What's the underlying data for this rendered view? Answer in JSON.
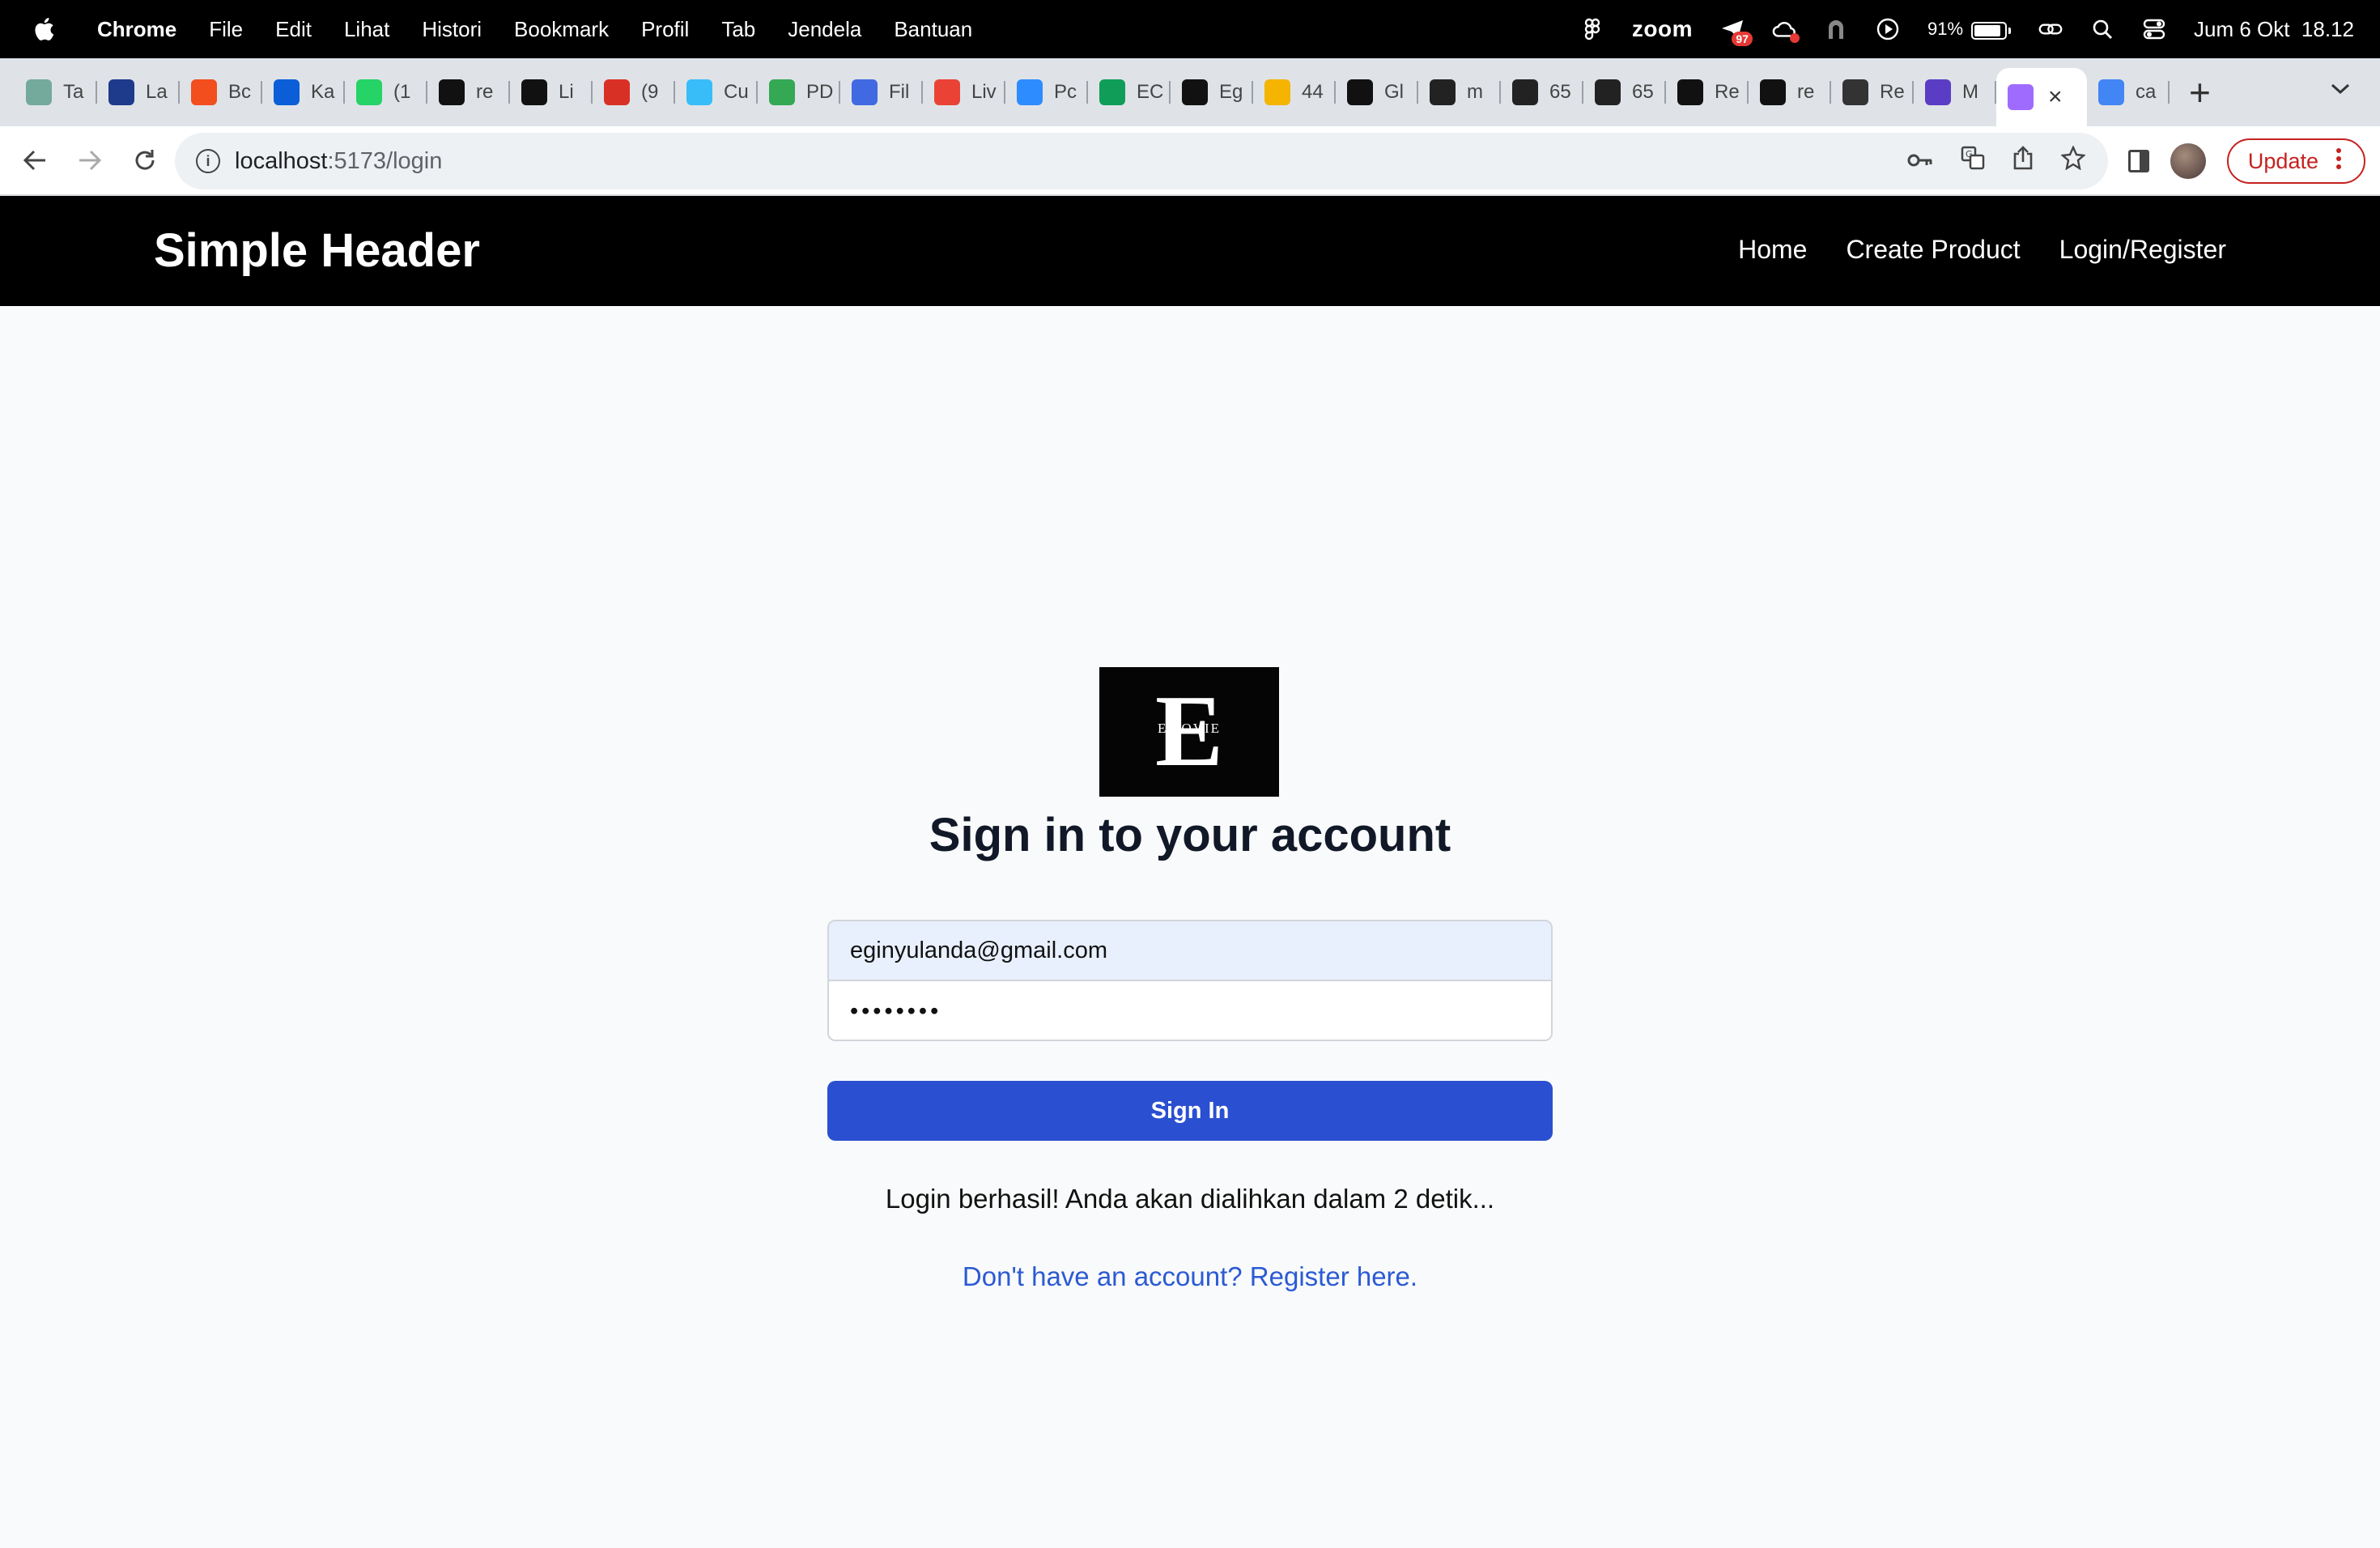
{
  "menubar": {
    "app": "Chrome",
    "items": [
      "File",
      "Edit",
      "Lihat",
      "Histori",
      "Bookmark",
      "Profil",
      "Tab",
      "Jendela",
      "Bantuan"
    ],
    "zoom_label": "zoom",
    "notification_count": "97",
    "battery_percent": "91%",
    "battery_level": 0.91,
    "datetime": "Jum 6 Okt  18.12"
  },
  "tabs": [
    {
      "title": "Ta",
      "icon": "chatgpt-icon",
      "color": "#74aa9c"
    },
    {
      "title": "La",
      "icon": "one-icon",
      "color": "#1e3a8a"
    },
    {
      "title": "Bc",
      "icon": "figma-icon",
      "color": "#f24e1e"
    },
    {
      "title": "Ka",
      "icon": "bank-icon",
      "color": "#0b5ed7"
    },
    {
      "title": "(1",
      "icon": "whatsapp-icon",
      "color": "#25d366"
    },
    {
      "title": "re",
      "icon": "github-icon",
      "color": "#111111"
    },
    {
      "title": "Li",
      "icon": "github-icon",
      "color": "#111111"
    },
    {
      "title": "(9",
      "icon": "badge-icon",
      "color": "#d93025"
    },
    {
      "title": "Cu",
      "icon": "tailwind-icon",
      "color": "#38bdf8"
    },
    {
      "title": "PD",
      "icon": "drive-icon",
      "color": "#34a853"
    },
    {
      "title": "Fil",
      "icon": "forms-icon",
      "color": "#4169e1"
    },
    {
      "title": "Liv",
      "icon": "gmail-icon",
      "color": "#ea4335"
    },
    {
      "title": "Pc",
      "icon": "zoom-icon",
      "color": "#2d8cff"
    },
    {
      "title": "EC",
      "icon": "sheets-icon",
      "color": "#0f9d58"
    },
    {
      "title": "Eg",
      "icon": "github-icon",
      "color": "#111111"
    },
    {
      "title": "44",
      "icon": "drive-icon",
      "color": "#f4b400"
    },
    {
      "title": "Gl",
      "icon": "seventeen-icon",
      "color": "#111111"
    },
    {
      "title": "m",
      "icon": "api-icon",
      "color": "#222222"
    },
    {
      "title": "65",
      "icon": "api-icon",
      "color": "#222222"
    },
    {
      "title": "65",
      "icon": "api-icon",
      "color": "#222222"
    },
    {
      "title": "Re",
      "icon": "github-icon",
      "color": "#111111"
    },
    {
      "title": "re",
      "icon": "github-icon",
      "color": "#111111"
    },
    {
      "title": "Re",
      "icon": "monitor-icon",
      "color": "#333333"
    },
    {
      "title": "M",
      "icon": "list-icon",
      "color": "#5b3cc4"
    },
    {
      "title": "",
      "icon": "vite-icon",
      "color": "#9f6bff",
      "active": true
    },
    {
      "title": "ca",
      "icon": "google-icon",
      "color": "#4285f4"
    }
  ],
  "toolbar": {
    "url_host": "localhost",
    "url_path": ":5173/login",
    "update_label": "Update"
  },
  "header": {
    "title": "Simple Header",
    "nav": [
      "Home",
      "Create Product",
      "Login/Register"
    ]
  },
  "login": {
    "logo_letter": "E",
    "logo_text": "EMOVIE",
    "heading": "Sign in to your account",
    "email_value": "eginyulanda@gmail.com",
    "password_value": "••••••••",
    "submit_label": "Sign In",
    "message": "Login berhasil! Anda akan dialihkan dalam 2 detik...",
    "register_link": "Don't have an account? Register here."
  },
  "colors": {
    "primary_button": "#2b4fd1",
    "link": "#2b5ad3",
    "header_bg": "#000000",
    "email_autofill_bg": "#e8f0fe"
  }
}
